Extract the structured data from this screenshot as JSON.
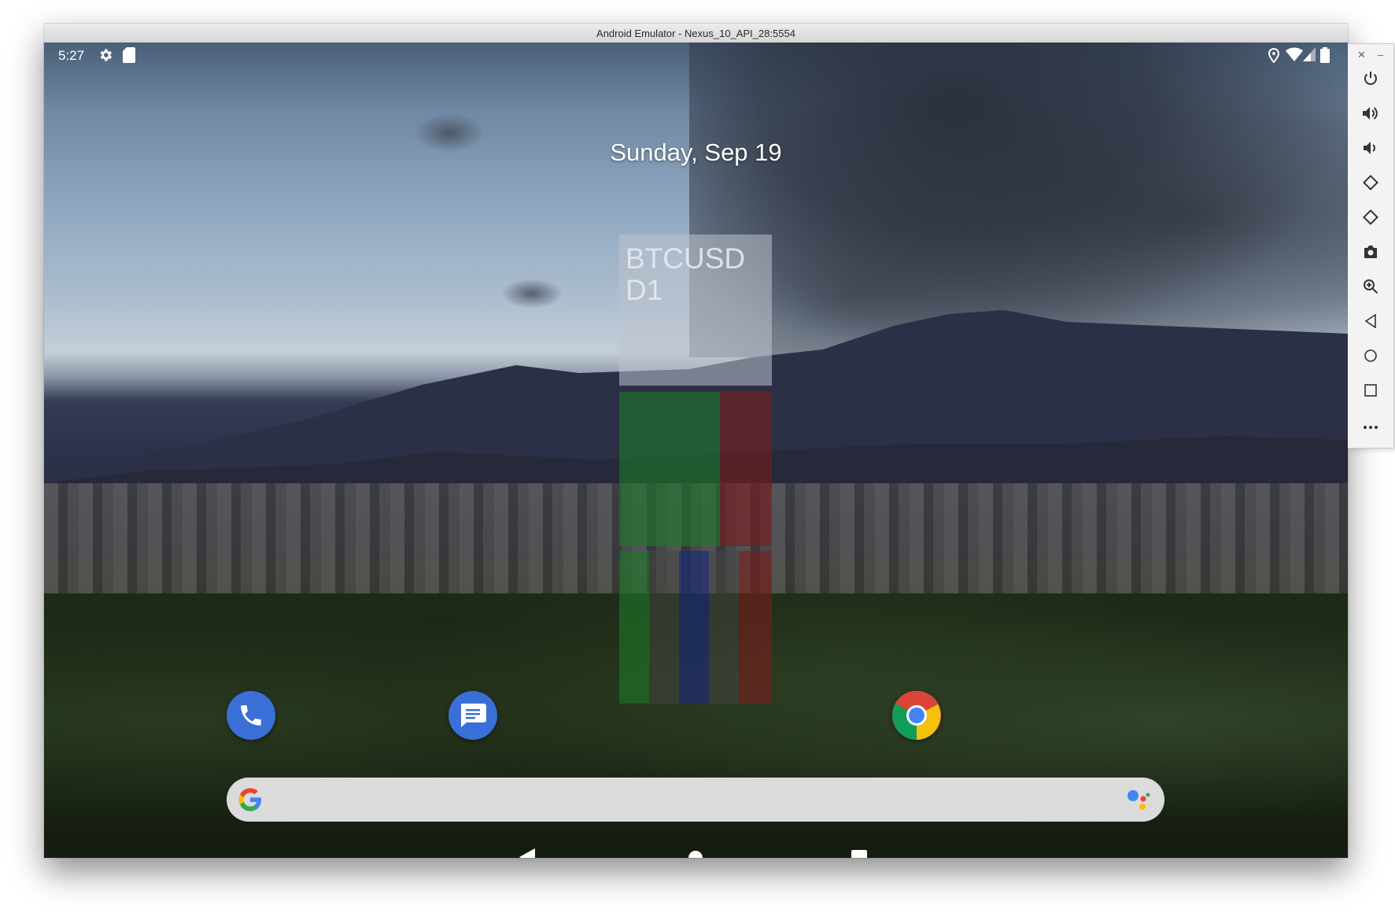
{
  "window": {
    "title": "Android Emulator - Nexus_10_API_28:5554"
  },
  "status_bar": {
    "time": "5:27",
    "left_icons": [
      "settings-icon",
      "sd-card-icon"
    ],
    "right_icons": [
      "location-icon",
      "wifi-icon",
      "signal-icon",
      "battery-icon"
    ]
  },
  "home": {
    "date": "Sunday, Sep 19"
  },
  "widget": {
    "symbol": "BTCUSD",
    "timeframe": "D1"
  },
  "dock": {
    "apps": [
      "phone-app",
      "messages-app",
      "chrome-app"
    ]
  },
  "search_bar": {
    "left_icon": "google-g-icon",
    "right_icon": "google-assistant-icon"
  },
  "nav_bar": {
    "buttons": [
      "back",
      "home",
      "recents"
    ]
  },
  "toolbar": {
    "buttons": [
      "power",
      "volume-up",
      "volume-down",
      "rotate-left",
      "rotate-right",
      "screenshot",
      "zoom",
      "back",
      "home",
      "overview",
      "more"
    ]
  },
  "colors": {
    "phone_icon_bg": "#3b6fd8",
    "messages_icon_bg": "#3b6fd8",
    "widget_green": "#1c7a2a",
    "widget_red": "#7a1c1c",
    "widget_blue": "#1c2a7a"
  }
}
